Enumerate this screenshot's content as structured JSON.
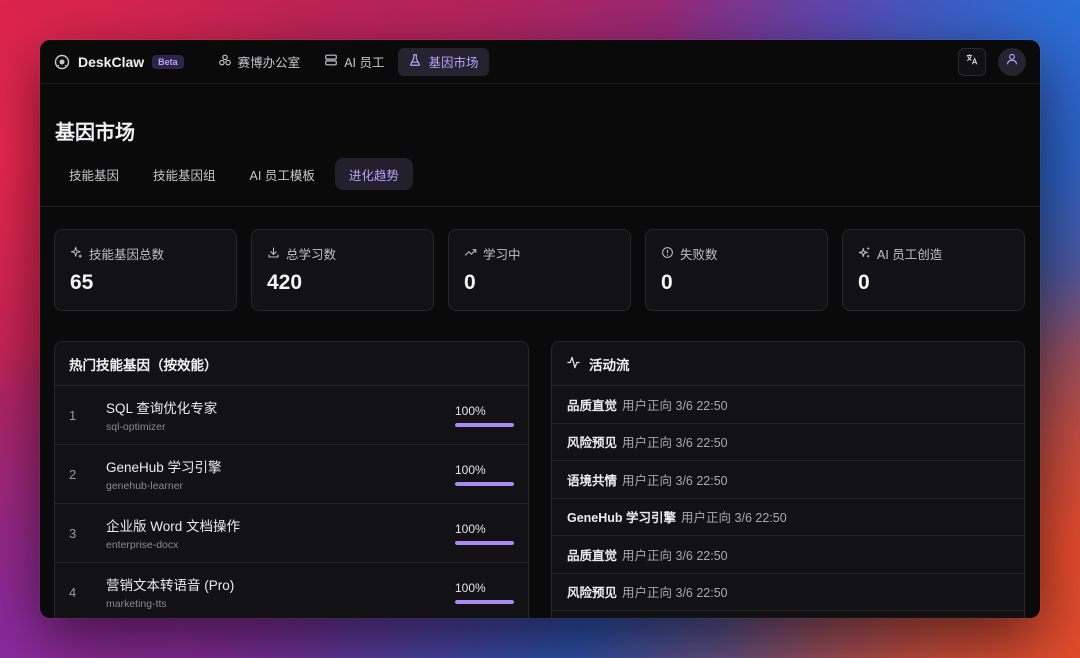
{
  "app": {
    "name": "DeskClaw",
    "badge": "Beta"
  },
  "nav": [
    {
      "label": "赛博办公室",
      "icon": "cluster-icon",
      "active": false
    },
    {
      "label": "AI 员工",
      "icon": "server-icon",
      "active": false
    },
    {
      "label": "基因市场",
      "icon": "flask-icon",
      "active": true
    }
  ],
  "topbar_right": [
    "translate-icon",
    "user-icon"
  ],
  "page": {
    "title": "基因市场",
    "tabs": [
      {
        "label": "技能基因",
        "active": false
      },
      {
        "label": "技能基因组",
        "active": false
      },
      {
        "label": "AI 员工模板",
        "active": false
      },
      {
        "label": "进化趋势",
        "active": true
      }
    ]
  },
  "stats": [
    {
      "label": "技能基因总数",
      "value": "65",
      "icon": "sparkle-icon"
    },
    {
      "label": "总学习数",
      "value": "420",
      "icon": "download-icon"
    },
    {
      "label": "学习中",
      "value": "0",
      "icon": "trending-up-icon"
    },
    {
      "label": "失败数",
      "value": "0",
      "icon": "alert-circle-icon"
    },
    {
      "label": "AI 员工创造",
      "value": "0",
      "icon": "sparkles-icon"
    }
  ],
  "top_genes": {
    "title": "热门技能基因（按效能）",
    "rows": [
      {
        "rank": "1",
        "name": "SQL 查询优化专家",
        "slug": "sql-optimizer",
        "score": "100%",
        "fill": 1.0
      },
      {
        "rank": "2",
        "name": "GeneHub 学习引擎",
        "slug": "genehub-learner",
        "score": "100%",
        "fill": 1.0
      },
      {
        "rank": "3",
        "name": "企业版 Word 文档操作",
        "slug": "enterprise-docx",
        "score": "100%",
        "fill": 1.0
      },
      {
        "rank": "4",
        "name": "营销文本转语音 (Pro)",
        "slug": "marketing-tts",
        "score": "100%",
        "fill": 1.0
      }
    ]
  },
  "activity": {
    "title": "活动流",
    "icon": "activity-icon",
    "rows": [
      {
        "name": "品质直觉",
        "meta": "用户正向 3/6 22:50"
      },
      {
        "name": "风险预见",
        "meta": "用户正向 3/6 22:50"
      },
      {
        "name": "语境共情",
        "meta": "用户正向 3/6 22:50"
      },
      {
        "name": "GeneHub 学习引擎",
        "meta": "用户正向 3/6 22:50"
      },
      {
        "name": "品质直觉",
        "meta": "用户正向 3/6 22:50"
      },
      {
        "name": "风险预见",
        "meta": "用户正向 3/6 22:50"
      }
    ]
  },
  "colors": {
    "accent": "#b9a4ff",
    "bar": "#a98bf5",
    "window_bg": "#0a0a0b"
  }
}
